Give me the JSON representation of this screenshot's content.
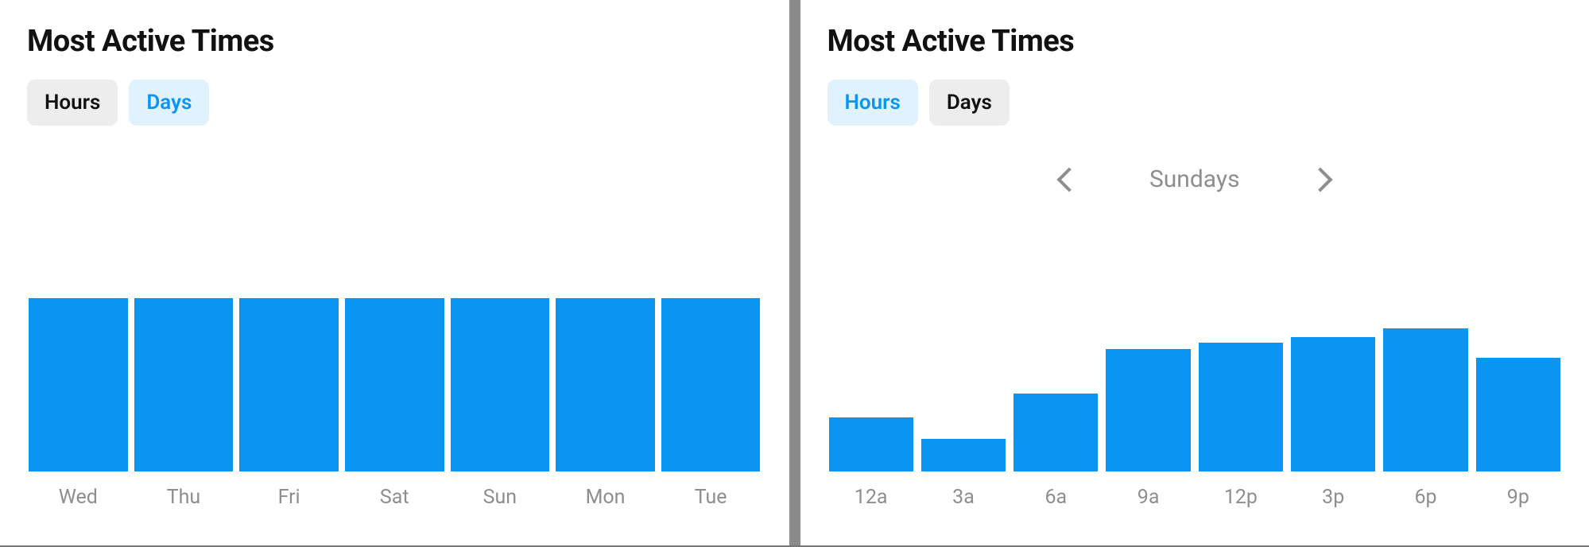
{
  "left": {
    "title": "Most Active Times",
    "tabs": {
      "hours": "Hours",
      "days": "Days",
      "active": "days"
    }
  },
  "right": {
    "title": "Most Active Times",
    "tabs": {
      "hours": "Hours",
      "days": "Days",
      "active": "hours"
    },
    "day_nav": {
      "label": "Sundays"
    }
  },
  "colors": {
    "bar": "#0a95f2",
    "tab_active_bg": "#e1f2ff",
    "tab_active_fg": "#0a95f2"
  },
  "chart_data": [
    {
      "type": "bar",
      "title": "Most Active Times — Days",
      "categories": [
        "Wed",
        "Thu",
        "Fri",
        "Sat",
        "Sun",
        "Mon",
        "Tue"
      ],
      "values": [
        100,
        100,
        100,
        100,
        100,
        100,
        100
      ],
      "ylim": [
        0,
        100
      ],
      "xlabel": "",
      "ylabel": ""
    },
    {
      "type": "bar",
      "title": "Most Active Times — Hours (Sundays)",
      "categories": [
        "12a",
        "3a",
        "6a",
        "9a",
        "12p",
        "3p",
        "6p",
        "9p"
      ],
      "values": [
        36,
        22,
        52,
        82,
        86,
        90,
        96,
        76
      ],
      "ylim": [
        0,
        100
      ],
      "xlabel": "",
      "ylabel": ""
    }
  ]
}
